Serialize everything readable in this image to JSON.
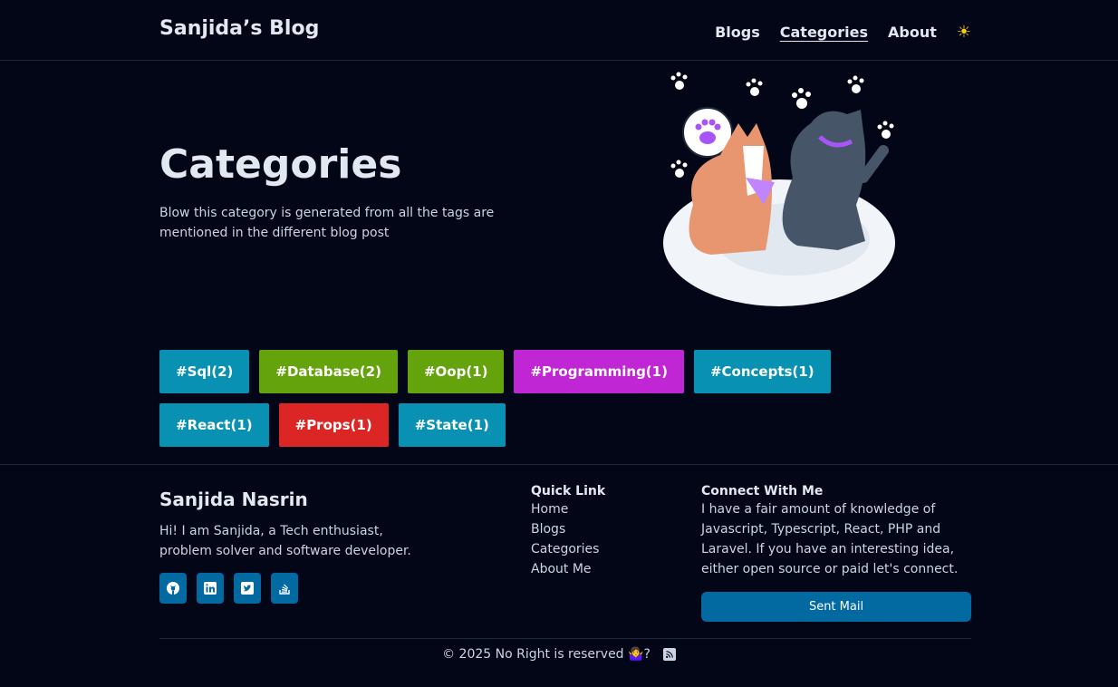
{
  "header": {
    "logo": "Sanjida’s Blog",
    "nav": [
      {
        "label": "Blogs",
        "active": false
      },
      {
        "label": "Categories",
        "active": true
      },
      {
        "label": "About",
        "active": false
      }
    ],
    "theme_icon": "sun-icon"
  },
  "hero": {
    "title": "Categories",
    "description": "Blow this category is generated from all the tags are mentioned in the different blog post"
  },
  "tags": [
    {
      "label": "#Sql(2)",
      "color": "#0891b2"
    },
    {
      "label": "#Database(2)",
      "color": "#65a30d"
    },
    {
      "label": "#Oop(1)",
      "color": "#65a30d"
    },
    {
      "label": "#Programming(1)",
      "color": "#c026d3"
    },
    {
      "label": "#Concepts(1)",
      "color": "#0891b2"
    },
    {
      "label": "#React(1)",
      "color": "#0891b2"
    },
    {
      "label": "#Props(1)",
      "color": "#dc2626"
    },
    {
      "label": "#State(1)",
      "color": "#0891b2"
    }
  ],
  "footer": {
    "name": "Sanjida Nasrin",
    "bio": "Hi! I am Sanjida, a Tech enthusiast, problem solver and software developer.",
    "socials": [
      "github-icon",
      "linkedin-icon",
      "twitter-icon",
      "stackoverflow-icon"
    ],
    "quick_link": {
      "title": "Quick Link",
      "links": [
        "Home",
        "Blogs",
        "Categories",
        "About Me"
      ]
    },
    "connect": {
      "title": "Connect With Me",
      "text": "I have a fair amount of knowledge of Javascript, Typescript, React, PHP and Laravel. If you have an interesting idea, either open source or paid let's connect.",
      "button": "Sent Mail"
    },
    "copyright": "© 2025 No Right is reserved 🤷‍♀️?",
    "rss_icon": "rss-icon"
  },
  "colors": {
    "background": "#020617",
    "accent": "#0369a1"
  }
}
